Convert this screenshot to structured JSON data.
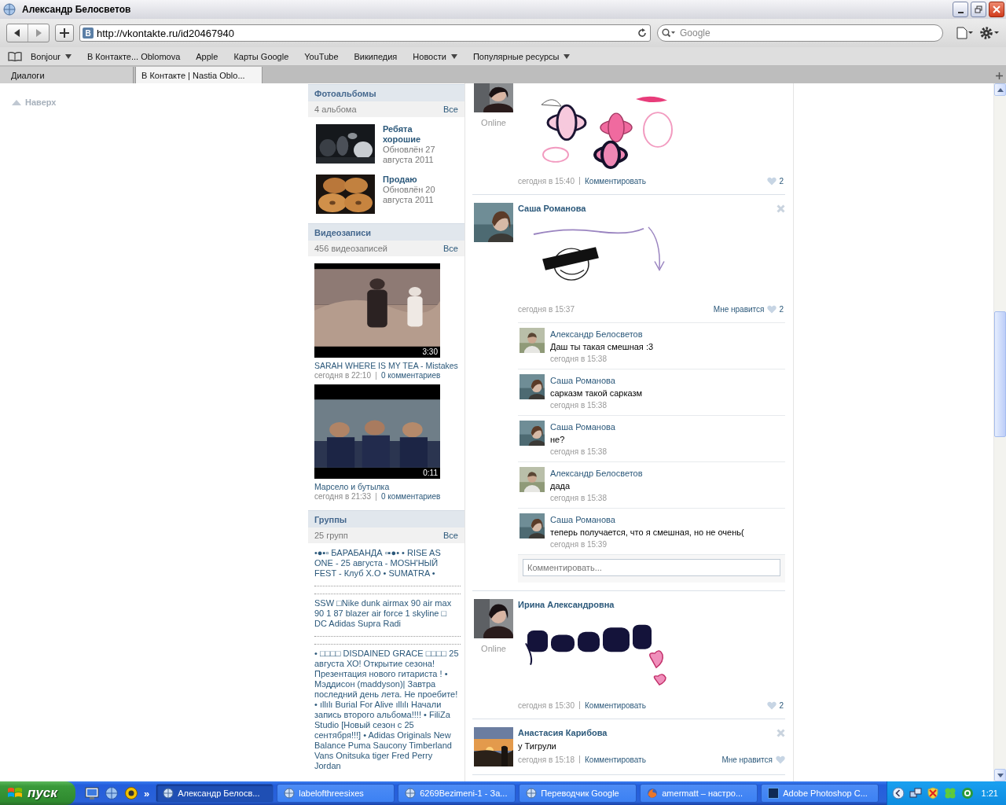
{
  "window": {
    "title": "Александр Белосветов"
  },
  "toolbar": {
    "site_badge": "В",
    "url": "http://vkontakte.ru/id20467940",
    "search": {
      "placeholder": "Google"
    }
  },
  "bookmarks": [
    {
      "label": "Bonjour",
      "menu": true
    },
    {
      "label": "В Контакте... Oblomova",
      "menu": false
    },
    {
      "label": "Apple",
      "menu": false
    },
    {
      "label": "Карты Google",
      "menu": false
    },
    {
      "label": "YouTube",
      "menu": false
    },
    {
      "label": "Википедия",
      "menu": false
    },
    {
      "label": "Новости",
      "menu": true
    },
    {
      "label": "Популярные ресурсы",
      "menu": true
    }
  ],
  "tabs": [
    {
      "label": "Диалоги",
      "selected": false
    },
    {
      "label": "В Контакте | Nastia Oblo...",
      "selected": true
    }
  ],
  "back_to_top": "Наверх",
  "sidebar": [
    {
      "kind": "albums",
      "title": "Фотоальбомы",
      "count": "4 альбома",
      "all": "Все",
      "items": [
        {
          "title": "Ребята хорошие",
          "updated": "Обновлён 27 августа 2011"
        },
        {
          "title": "Продаю",
          "updated": "Обновлён 20 августа 2011"
        }
      ]
    },
    {
      "kind": "videos",
      "title": "Видеозаписи",
      "count": "456 видеозаписей",
      "all": "Все",
      "items": [
        {
          "title": "SARAH WHERE IS MY TEA - Mistakes",
          "duration": "3:30",
          "date": "сегодня в 22:10",
          "comments": "0 комментариев"
        },
        {
          "title": "Марсело и бутылка",
          "duration": "0:11",
          "date": "сегодня в 21:33",
          "comments": "0 комментариев"
        }
      ]
    },
    {
      "kind": "groups",
      "title": "Группы",
      "count": "25 групп",
      "all": "Все",
      "items": [
        "•●▪▫ БАРАБАНДА ▫▪●• • RISE AS ONE - 25 августа - MOSH'НЫЙ FEST - Клуб Х.О • SUMATRA •",
        "SSW □Nike dunk airmax 90 air max 90 1 87 blazer air force 1 skyline □ DC Adidas Supra Radi",
        "• □□□□ DISDAINED GRACE □□□□ 25 августа ХО! Открытие сезона! Презентация нового гитариста ! • Мэддисон (maddyson)| Завтра последний день лета. Не проебите! • ıllılı Burial For Alive ıllılı Начали запись второго альбома!!!! • FiliZa Studio [Новый сезон с 25 сентября!!!] • Adidas Originals New Balance Puma Saucony Timberland Vans Onitsuka tiger Fred Perry Jordan"
      ]
    }
  ],
  "feed": [
    {
      "status": "Online",
      "removable": false,
      "attachment": {
        "kind": "picture"
      },
      "time": "сегодня в 15:40",
      "comment_link": "Комментировать",
      "likes": "2"
    },
    {
      "author": "Саша Романова",
      "removable": true,
      "attachment": {
        "kind": "picture"
      },
      "time": "сегодня в 15:37",
      "like_label": "Мне нравится",
      "likes": "2",
      "comments": [
        {
          "author": "Александр Белосветов",
          "text": "Даш ты такая смешная :3",
          "time": "сегодня в 15:38"
        },
        {
          "author": "Саша Романова",
          "text": "сарказм такой сарказм",
          "time": "сегодня в 15:38"
        },
        {
          "author": "Саша Романова",
          "text": "не?",
          "time": "сегодня в 15:38"
        },
        {
          "author": "Александр Белосветов",
          "text": "дада",
          "time": "сегодня в 15:38"
        },
        {
          "author": "Саша Романова",
          "text": "теперь получается, что я смешная, но не очень(",
          "time": "сегодня в 15:39"
        }
      ],
      "comment_placeholder": "Комментировать..."
    },
    {
      "author": "Ирина Александровна",
      "status": "Online",
      "removable": false,
      "attachment": {
        "kind": "picture"
      },
      "time": "сегодня в 15:30",
      "comment_link": "Комментировать",
      "likes": "2"
    },
    {
      "author": "Анастасия Карибова",
      "removable": true,
      "text": "у Тигрули",
      "time": "сегодня в 15:18",
      "comment_link": "Комментировать",
      "like_label": "Мне нравится"
    }
  ],
  "taskbar": {
    "start": "пуск",
    "quick_launch": [
      {
        "kind": "desktop"
      },
      {
        "kind": "globe"
      },
      {
        "kind": "messenger"
      }
    ],
    "more": "»",
    "tasks": [
      {
        "label": "Александр Белосв...",
        "kind": "globe",
        "selected": true
      },
      {
        "label": "labelofthreesixes",
        "kind": "globe",
        "selected": false
      },
      {
        "label": "6269Bezimeni-1 - За...",
        "kind": "globe",
        "selected": false
      },
      {
        "label": "Переводчик Google",
        "kind": "globe",
        "selected": false
      },
      {
        "label": "amermatt – настро...",
        "kind": "fox",
        "selected": false
      },
      {
        "label": "Adobe Photoshop C...",
        "kind": "square",
        "selected": false
      }
    ],
    "clock": "1:21"
  }
}
